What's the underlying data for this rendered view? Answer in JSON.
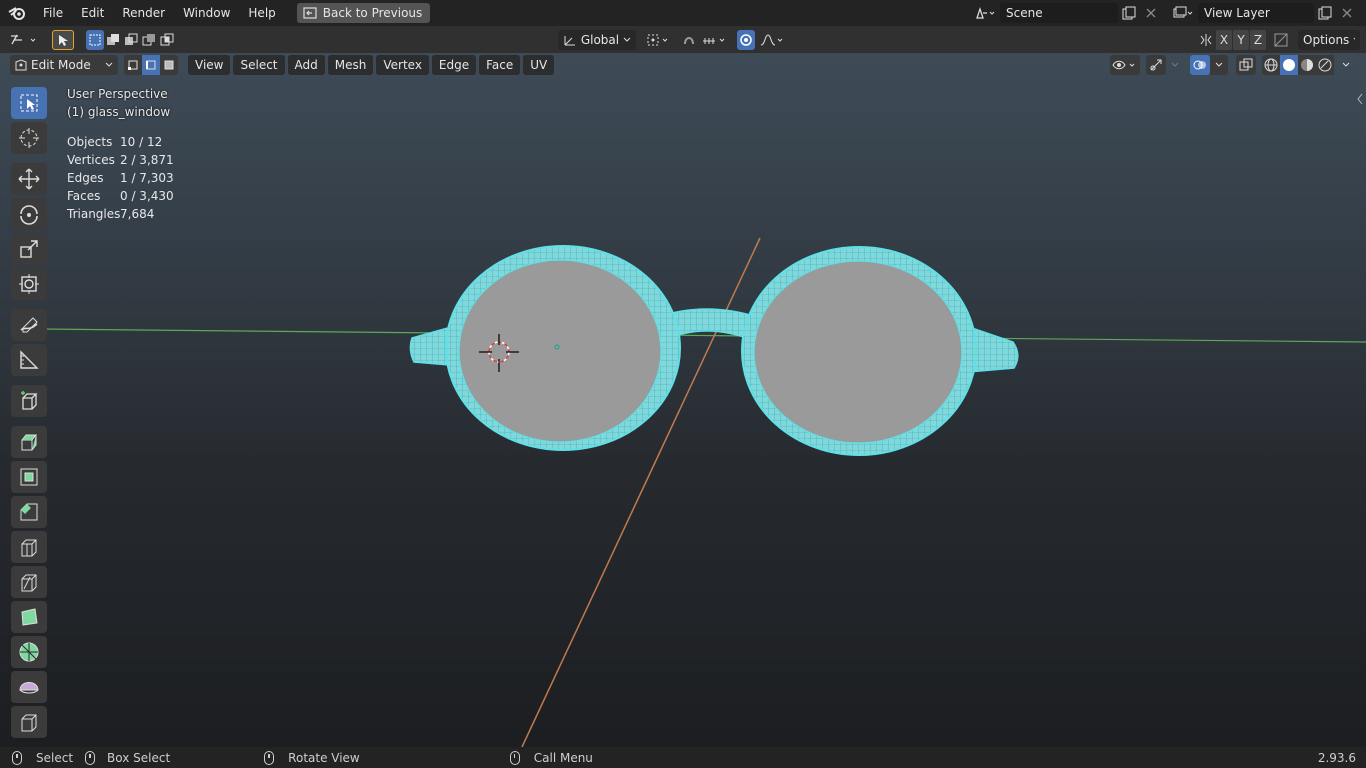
{
  "menubar": {
    "items": [
      "File",
      "Edit",
      "Render",
      "Window",
      "Help"
    ],
    "back_button": "Back to Previous",
    "scene": "Scene",
    "view_layer": "View Layer"
  },
  "toolsettings": {
    "transform_orientation": "Global",
    "axes": [
      "X",
      "Y",
      "Z"
    ],
    "options": "Options"
  },
  "viewport_header": {
    "mode": "Edit Mode",
    "menus": [
      "View",
      "Select",
      "Add",
      "Mesh",
      "Vertex",
      "Edge",
      "Face",
      "UV"
    ]
  },
  "viewport": {
    "perspective": "User Perspective",
    "object": "(1) glass_window",
    "stats": [
      {
        "label": "Objects",
        "value": "10 / 12"
      },
      {
        "label": "Vertices",
        "value": "2 / 3,871"
      },
      {
        "label": "Edges",
        "value": "1 / 7,303"
      },
      {
        "label": "Faces",
        "value": "0 / 3,430"
      },
      {
        "label": "Triangles",
        "value": "7,684"
      }
    ]
  },
  "statusbar": {
    "select": "Select",
    "box_select": "Box Select",
    "rotate_view": "Rotate View",
    "call_menu": "Call Menu",
    "version": "2.93.6"
  },
  "colors": {
    "accent": "#4772b3",
    "wire": "#5fe0e6",
    "lens": "#9a9a9a",
    "x_axis": "#c07a4d",
    "y_axis": "#5da85a"
  }
}
